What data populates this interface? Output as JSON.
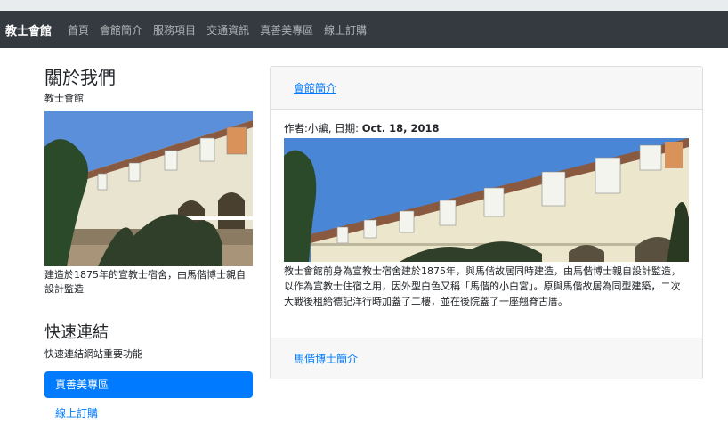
{
  "navbar": {
    "brand": "教士會館",
    "links": [
      "首頁",
      "會館簡介",
      "服務項目",
      "交通資訊",
      "真善美專區",
      "線上訂購"
    ]
  },
  "sidebar": {
    "about_title": "關於我們",
    "about_subtitle": "教士會館",
    "photo_caption": "建造於1875年的宣教士宿舍，由馬偕博士親自設計監造",
    "links_title": "快速連結",
    "links_subtitle": "快速連結網站重要功能",
    "primary_link": "真善美專區",
    "secondary_link": "線上訂購"
  },
  "card": {
    "header_link": "會館簡介",
    "meta_author": "作者:小編, 日期: ",
    "meta_date": "Oct. 18, 2018",
    "body": "教士會館前身為宣教士宿舍建於1875年，與馬偕故居同時建造，由馬偕博士親自設計監造，以作為宣教士住宿之用，因外型白色又稱「馬偕的小白宮」。原與馬偕故居為同型建築，二次大戰後租給德記洋行時加蓋了二樓，並在後院蓋了一座翹脊古厝。",
    "footer_link": "馬偕博士簡介"
  },
  "colors": {
    "navbar_bg": "#343a40",
    "primary": "#007bff",
    "card_header_bg": "#f7f7f7"
  }
}
